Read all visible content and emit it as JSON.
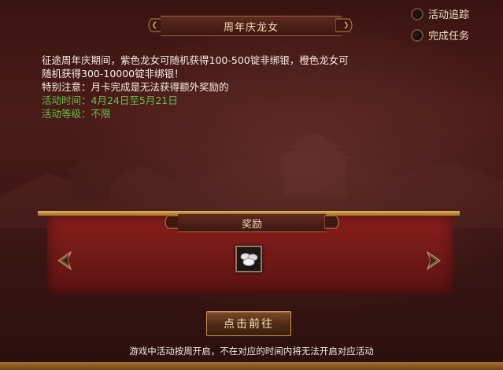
{
  "header": {
    "title": "周年庆龙女"
  },
  "tracking": {
    "activity_tracking_label": "活动追踪",
    "complete_task_label": "完成任务"
  },
  "description": {
    "line1": "征途周年庆期间，紫色龙女可随机获得100-500锭非绑银，橙色龙女可",
    "line2": "随机获得300-10000锭非绑银！",
    "line3": "特别注意：月卡完成是无法获得额外奖励的",
    "time_label": "活动时间：",
    "time_value": "4月24日至5月21日",
    "level_label": "活动等级：",
    "level_value": "不限"
  },
  "reward": {
    "title": "奖励",
    "items": [
      {
        "icon": "silver-ingot-icon"
      }
    ]
  },
  "actions": {
    "go_button": "点击前往"
  },
  "footer": {
    "note": "游戏中活动按周开启，不在对应的时间内将无法开启对应活动"
  },
  "colors": {
    "highlight_green": "#62c24a",
    "panel_red": "#7a1c1a",
    "gold": "#e3b25a"
  }
}
